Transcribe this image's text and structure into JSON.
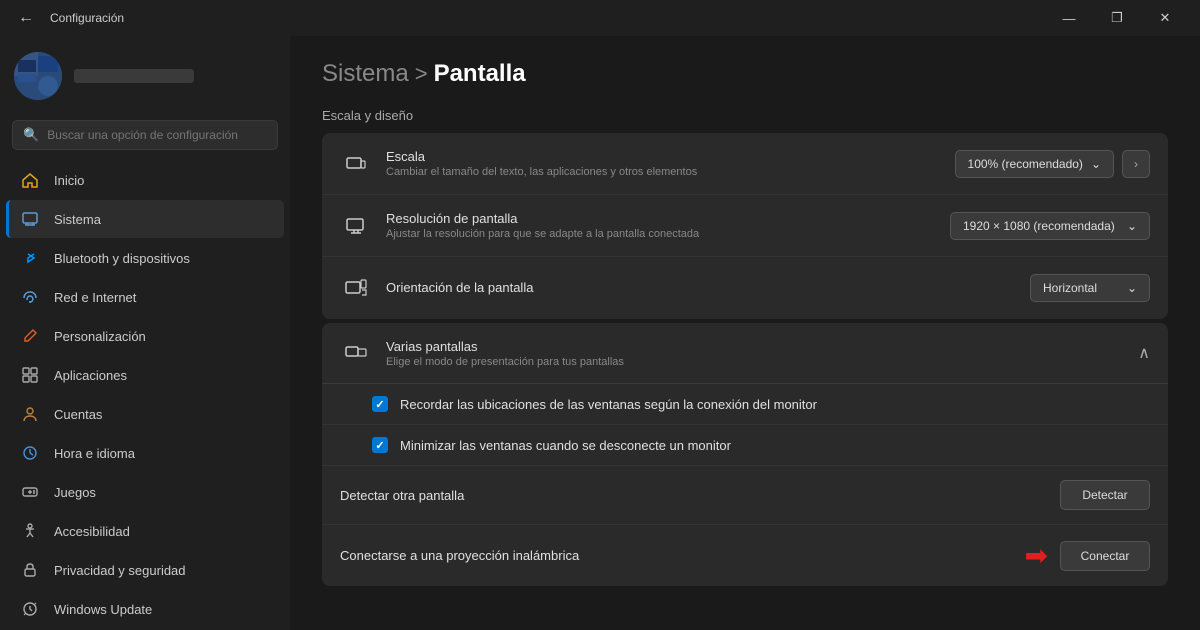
{
  "titlebar": {
    "back_icon": "←",
    "title": "Configuración",
    "minimize": "—",
    "maximize": "❐",
    "close": "✕"
  },
  "sidebar": {
    "search_placeholder": "Buscar una opción de configuración",
    "nav_items": [
      {
        "id": "inicio",
        "label": "Inicio",
        "icon": "⌂",
        "icon_class": "home",
        "active": false
      },
      {
        "id": "sistema",
        "label": "Sistema",
        "icon": "🖥",
        "icon_class": "sistema",
        "active": true
      },
      {
        "id": "bluetooth",
        "label": "Bluetooth y dispositivos",
        "icon": "⬡",
        "icon_class": "bluetooth",
        "active": false
      },
      {
        "id": "red",
        "label": "Red e Internet",
        "icon": "◈",
        "icon_class": "red",
        "active": false
      },
      {
        "id": "personaliz",
        "label": "Personalización",
        "icon": "✏",
        "icon_class": "personaliz",
        "active": false
      },
      {
        "id": "apps",
        "label": "Aplicaciones",
        "icon": "⊞",
        "icon_class": "apps",
        "active": false
      },
      {
        "id": "cuentas",
        "label": "Cuentas",
        "icon": "👤",
        "icon_class": "cuentas",
        "active": false
      },
      {
        "id": "hora",
        "label": "Hora e idioma",
        "icon": "🕐",
        "icon_class": "hora",
        "active": false
      },
      {
        "id": "juegos",
        "label": "Juegos",
        "icon": "🎮",
        "icon_class": "juegos",
        "active": false
      },
      {
        "id": "accesib",
        "label": "Accesibilidad",
        "icon": "♿",
        "icon_class": "accesib",
        "active": false
      },
      {
        "id": "privacidad",
        "label": "Privacidad y seguridad",
        "icon": "🔒",
        "icon_class": "privacidad",
        "active": false
      },
      {
        "id": "windows",
        "label": "Windows Update",
        "icon": "⟳",
        "icon_class": "windows",
        "active": false
      }
    ]
  },
  "content": {
    "breadcrumb_parent": "Sistema",
    "breadcrumb_sep": ">",
    "breadcrumb_current": "Pantalla",
    "section_title": "Escala y diseño",
    "rows": [
      {
        "id": "escala",
        "title": "Escala",
        "desc": "Cambiar el tamaño del texto, las aplicaciones y otros elementos",
        "control_type": "dropdown_with_arrow",
        "value": "100% (recomendado)"
      },
      {
        "id": "resolucion",
        "title": "Resolución de pantalla",
        "desc": "Ajustar la resolución para que se adapte a la pantalla conectada",
        "control_type": "dropdown",
        "value": "1920 × 1080 (recomendada)"
      },
      {
        "id": "orientacion",
        "title": "Orientación de la pantalla",
        "desc": "",
        "control_type": "dropdown",
        "value": "Horizontal"
      }
    ],
    "varias_pantallas": {
      "title": "Varias pantallas",
      "desc": "Elige el modo de presentación para tus pantallas",
      "sub_rows": [
        {
          "id": "recordar",
          "label": "Recordar las ubicaciones de las ventanas según la conexión del monitor",
          "checked": true
        },
        {
          "id": "minimizar",
          "label": "Minimizar las ventanas cuando se desconecte un monitor",
          "checked": true
        }
      ]
    },
    "detectar": {
      "label": "Detectar otra pantalla",
      "btn": "Detectar"
    },
    "conectar": {
      "label": "Conectarse a una proyección inalámbrica",
      "btn": "Conectar"
    }
  }
}
